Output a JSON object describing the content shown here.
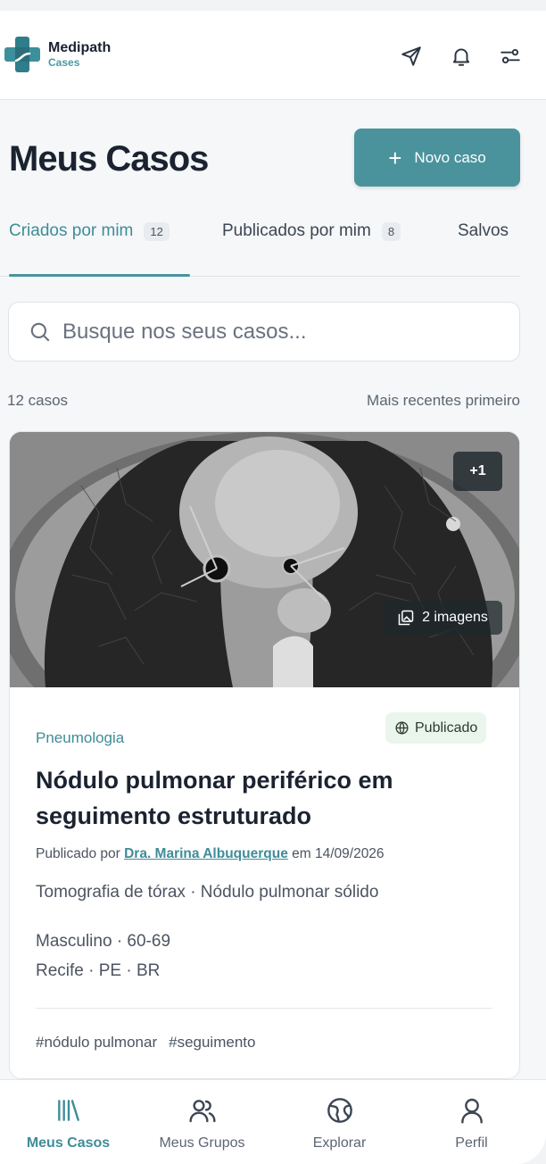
{
  "brand": {
    "name": "Medipath",
    "sub": "Cases"
  },
  "header": {
    "icons": [
      "send-icon",
      "bell-icon",
      "settings-sliders-icon"
    ]
  },
  "page": {
    "title": "Meus Casos",
    "new_case_label": "Novo caso"
  },
  "tabs": [
    {
      "label": "Criados por mim",
      "count": "12",
      "active": true
    },
    {
      "label": "Publicados por mim",
      "count": "8",
      "active": false
    },
    {
      "label": "Salvos",
      "count": "",
      "active": false
    }
  ],
  "search": {
    "placeholder": "Busque nos seus casos..."
  },
  "list": {
    "count_label": "12 casos",
    "sort_label": "Mais recentes primeiro"
  },
  "case": {
    "extra_images": "+1",
    "image_count": "2 imagens",
    "specialty": "Pneumologia",
    "status": "Publicado",
    "title": "Nódulo pulmonar periférico em seguimento estruturado",
    "byline_prefix": "Publicado por ",
    "author": "Dra. Marina Albuquerque",
    "byline_suffix": " em 14/09/2026",
    "exam": "Tomografia de tórax · Nódulo pulmonar sólido",
    "demographics": "Masculino · 60-69",
    "location": "Recife · PE · BR",
    "tags": [
      "#nódulo pulmonar",
      "#seguimento"
    ]
  },
  "bottom_nav": [
    {
      "label": "Meus Casos",
      "icon": "library-icon",
      "active": true
    },
    {
      "label": "Meus Grupos",
      "icon": "users-icon",
      "active": false
    },
    {
      "label": "Explorar",
      "icon": "globe-icon",
      "active": false
    },
    {
      "label": "Perfil",
      "icon": "user-icon",
      "active": false
    }
  ],
  "colors": {
    "accent": "#4a939d",
    "accent_text": "#3f8c98",
    "published_bg": "#eaf5ec"
  }
}
